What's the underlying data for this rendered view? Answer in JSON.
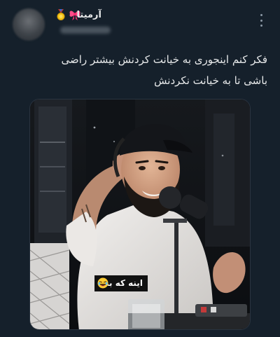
{
  "tweet": {
    "display_name": "آرمیتا",
    "text_line_1": "فکر کنم اینجوری به خیانت کردنش بیشتر راضی",
    "text_line_2": "باشی تا به خیانت نکردنش",
    "icons": {
      "medal": "medal-icon",
      "ribbon": "ribbon-icon",
      "more": "more-icon",
      "laugh": "laughing-emoji-icon"
    }
  },
  "media": {
    "caption_text": "اینه که بده"
  },
  "colors": {
    "background": "#15202b",
    "text": "#e7e9ea",
    "secondary": "#8b98a5"
  }
}
